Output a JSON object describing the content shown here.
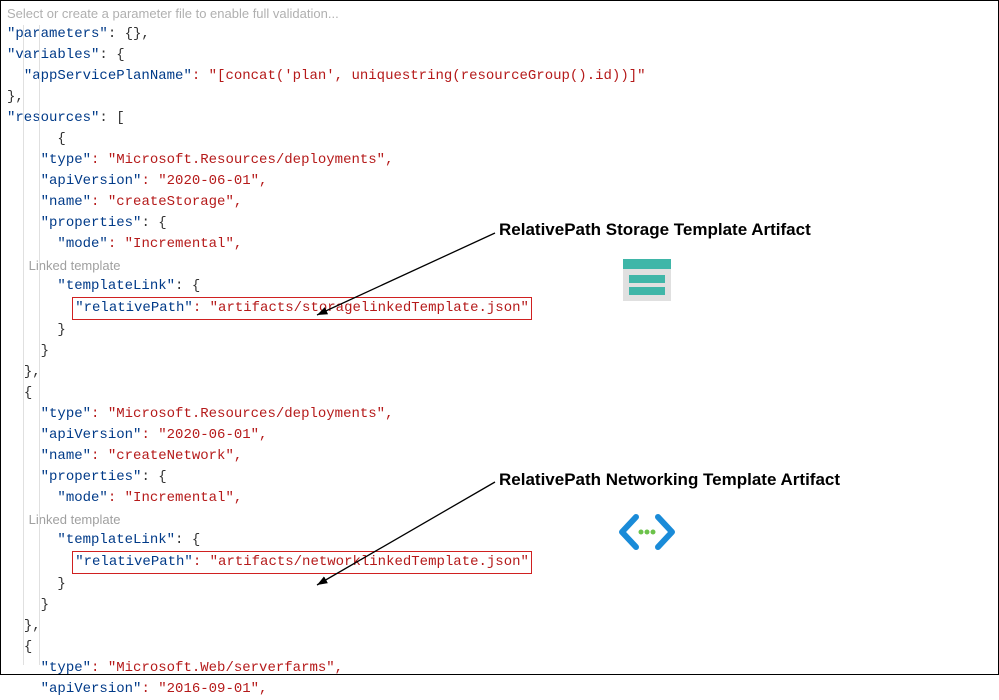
{
  "editor": {
    "placeholder": "Select or create a parameter file to enable full validation...",
    "linked_template_hint": "Linked template"
  },
  "json": {
    "parameters_key": "\"parameters\"",
    "parameters_val": ": {},",
    "variables_key": "\"variables\"",
    "variables_open": ": {",
    "appServicePlanName_key": "\"appServicePlanName\"",
    "appServicePlanName_val": ": \"[concat('plan', uniquestring(resourceGroup().id))]\"",
    "close_brace_comma": "},",
    "resources_key": "\"resources\"",
    "resources_open": ": [",
    "open_brace": "{",
    "type_key": "\"type\"",
    "type_deployments": ": \"Microsoft.Resources/deployments\",",
    "apiVersion_key": "\"apiVersion\"",
    "apiVersion_2020": ": \"2020-06-01\",",
    "name_key": "\"name\"",
    "name_storage": ": \"createStorage\",",
    "name_network": ": \"createNetwork\",",
    "properties_key": "\"properties\"",
    "properties_open": ": {",
    "mode_key": "\"mode\"",
    "mode_val": ": \"Incremental\",",
    "templateLink_key": "\"templateLink\"",
    "templateLink_open": ": {",
    "relativePath_key": "\"relativePath\"",
    "relativePath_storage": ": \"artifacts/storagelinkedTemplate.json\"",
    "relativePath_network": ": \"artifacts/networklinkedTemplate.json\"",
    "close_brace": "}",
    "type_serverfarms": ": \"Microsoft.Web/serverfarms\",",
    "apiVersion_2016": ": \"2016-09-01\","
  },
  "annotations": {
    "storage_label": "RelativePath Storage Template Artifact",
    "network_label": "RelativePath Networking Template Artifact"
  }
}
